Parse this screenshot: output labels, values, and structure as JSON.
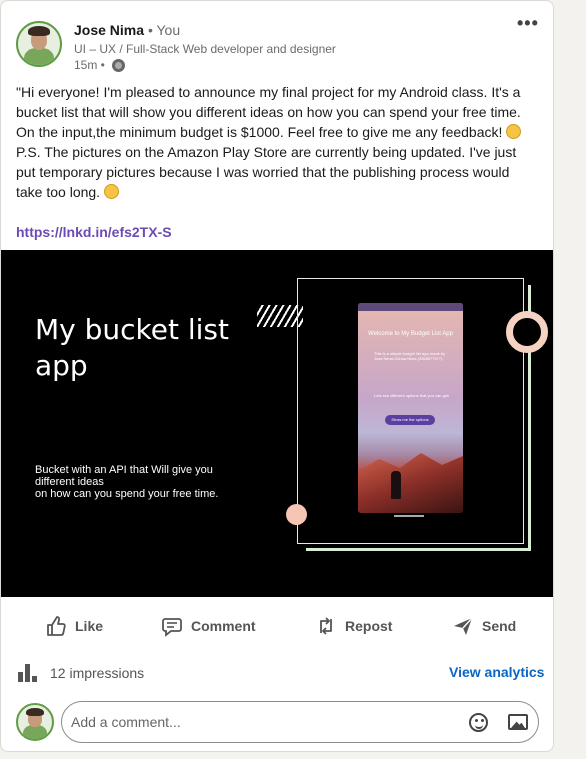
{
  "post": {
    "author_name": "Jose Nima",
    "author_relation": "• You",
    "author_headline": "UI – UX / Full-Stack Web developer and designer",
    "time": "15m •",
    "more_label": "•••",
    "body_lines": [
      "\"Hi everyone! I'm pleased to announce my final project for my Android class. It's a",
      "bucket list that will show you different ideas on how you can spend your free time.",
      "On the input,the minimum budget is $1000. Feel free to give me any feedback!",
      "P.S. The pictures on the Amazon Play Store are currently being updated. I've just",
      "put temporary pictures because I was worried that the publishing process would",
      "take too long."
    ],
    "link": "https://lnkd.in/efs2TX-S"
  },
  "media": {
    "title": "My bucket list app",
    "description_line1": "Bucket with an API that Will give you different ideas",
    "description_line2": "on how can you spend your free time.",
    "phone_title": "Welcome to My Budget List App",
    "phone_text": "This is a simple budget list app made by Jose Nima-Ochoa Nima (3368577577).",
    "phone_text2": "Lets see different options that you can get!",
    "phone_button": "Show me the options"
  },
  "actions": {
    "like": "Like",
    "comment": "Comment",
    "repost": "Repost",
    "send": "Send"
  },
  "stats": {
    "impressions": "12 impressions",
    "analytics": "View analytics"
  },
  "comment_box": {
    "placeholder": "Add a comment..."
  },
  "colors": {
    "link": "#6a4bb3",
    "analytics": "#0a66c2",
    "accent_green": "#5f9c44"
  },
  "icons": [
    "globe-icon",
    "more-icon",
    "like-icon",
    "comment-icon",
    "repost-icon",
    "send-icon",
    "impressions-icon",
    "emoji-icon",
    "image-icon"
  ]
}
